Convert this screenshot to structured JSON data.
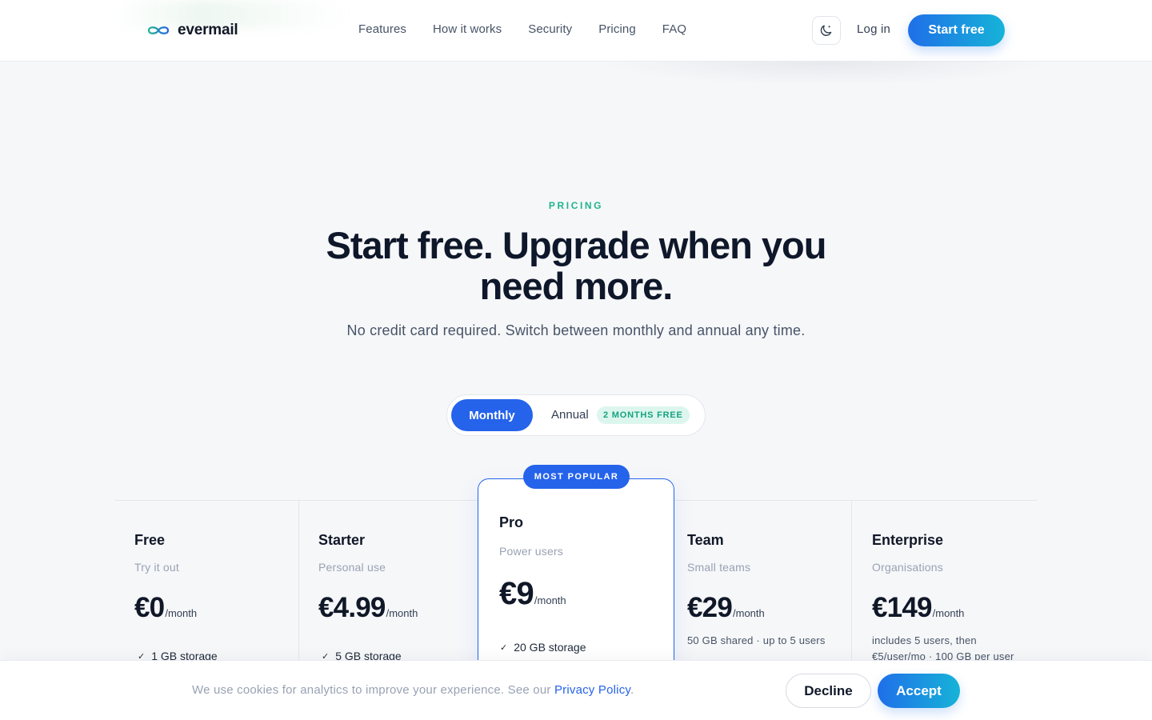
{
  "header": {
    "brand": "evermail",
    "nav": [
      "Features",
      "How it works",
      "Security",
      "Pricing",
      "FAQ"
    ],
    "theme_icon": "moon-icon",
    "login": "Log in",
    "cta": "Start free"
  },
  "hero": {
    "eyebrow": "PRICING",
    "headline_line1": "Start free. Upgrade when you",
    "headline_line2": "need more.",
    "subline": "No credit card required. Switch between monthly and annual any time."
  },
  "billing": {
    "monthly": "Monthly",
    "annual": "Annual",
    "annual_badge": "2 MONTHS FREE",
    "selected": "Monthly"
  },
  "plans": [
    {
      "name": "Free",
      "subtitle": "Try it out",
      "price": "€0",
      "period": "/month",
      "features": [
        "1 GB storage"
      ]
    },
    {
      "name": "Starter",
      "subtitle": "Personal use",
      "price": "€4.99",
      "period": "/month",
      "features": [
        "5 GB storage"
      ]
    },
    {
      "name": "Pro",
      "subtitle": "Power users",
      "price": "€9",
      "period": "/month",
      "badge": "MOST POPULAR",
      "features": [
        "20 GB storage"
      ]
    },
    {
      "name": "Team",
      "subtitle": "Small teams",
      "price": "€29",
      "period": "/month",
      "note": "50 GB shared · up to 5 users"
    },
    {
      "name": "Enterprise",
      "subtitle": "Organisations",
      "price": "€149",
      "period": "/month",
      "note_line1": "includes 5 users, then",
      "note_line2": "€5/user/mo · 100 GB per user"
    }
  ],
  "cookie": {
    "text": "We use cookies for analytics to improve your experience. See our ",
    "link": "Privacy Policy",
    "suffix": ".",
    "decline": "Decline",
    "accept": "Accept"
  },
  "colors": {
    "accent": "#2563eb",
    "accent_gradient_end": "#16b3d8",
    "eyebrow": "#1fb48e",
    "badge_bg": "#dcf6ee"
  }
}
